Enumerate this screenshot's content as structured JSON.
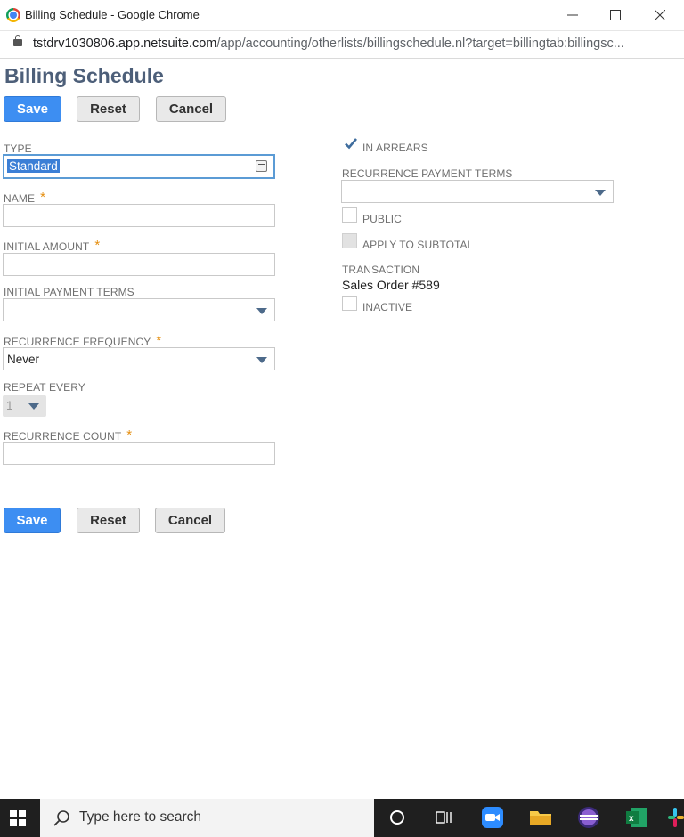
{
  "window": {
    "title": "Billing Schedule - Google Chrome",
    "url_host": "tstdrv1030806.app.netsuite.com",
    "url_path": "/app/accounting/otherlists/billingschedule.nl?target=billingtab:billingsc..."
  },
  "page": {
    "title": "Billing Schedule"
  },
  "buttons": {
    "save": "Save",
    "reset": "Reset",
    "cancel": "Cancel"
  },
  "form": {
    "type": {
      "label": "TYPE",
      "value": "Standard"
    },
    "name": {
      "label": "NAME",
      "value": "",
      "required": "*"
    },
    "initial_amount": {
      "label": "INITIAL AMOUNT",
      "value": "",
      "required": "*"
    },
    "initial_payment_terms": {
      "label": "INITIAL PAYMENT TERMS",
      "value": ""
    },
    "recurrence_frequency": {
      "label": "RECURRENCE FREQUENCY",
      "value": "Never",
      "required": "*"
    },
    "repeat_every": {
      "label": "REPEAT EVERY",
      "value": "1"
    },
    "recurrence_count": {
      "label": "RECURRENCE COUNT",
      "value": "",
      "required": "*"
    },
    "in_arrears": {
      "label": "IN ARREARS",
      "checked": true
    },
    "recurrence_payment_terms": {
      "label": "RECURRENCE PAYMENT TERMS",
      "value": ""
    },
    "public": {
      "label": "PUBLIC",
      "checked": false
    },
    "apply_to_subtotal": {
      "label": "APPLY TO SUBTOTAL",
      "checked": false
    },
    "transaction": {
      "label": "TRANSACTION",
      "value": "Sales Order #589"
    },
    "inactive": {
      "label": "INACTIVE",
      "checked": false
    }
  },
  "taskbar": {
    "search_placeholder": "Type here to search"
  },
  "colors": {
    "primary_button": "#3d8ef2",
    "title": "#4d5f79",
    "required": "#e58e0f",
    "taskbar": "#1f1f1f"
  }
}
